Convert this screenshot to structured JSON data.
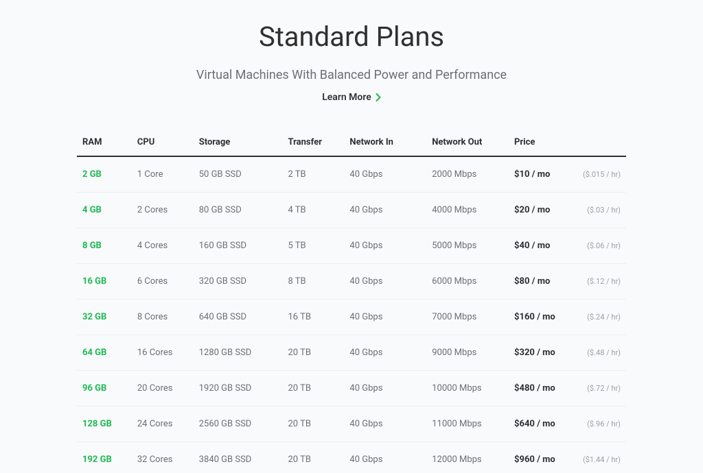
{
  "header": {
    "title": "Standard Plans",
    "subtitle": "Virtual Machines With Balanced Power and Performance",
    "learn_more": "Learn More"
  },
  "columns": {
    "ram": "RAM",
    "cpu": "CPU",
    "storage": "Storage",
    "transfer": "Transfer",
    "net_in": "Network In",
    "net_out": "Network Out",
    "price": "Price"
  },
  "rows": [
    {
      "ram": "2 GB",
      "cpu": "1 Core",
      "storage": "50 GB SSD",
      "transfer": "2 TB",
      "net_in": "40 Gbps",
      "net_out": "2000 Mbps",
      "price": "$10 / mo",
      "price_hr": "($.015 / hr)"
    },
    {
      "ram": "4 GB",
      "cpu": "2 Cores",
      "storage": "80 GB SSD",
      "transfer": "4 TB",
      "net_in": "40 Gbps",
      "net_out": "4000 Mbps",
      "price": "$20 / mo",
      "price_hr": "($.03 / hr)"
    },
    {
      "ram": "8 GB",
      "cpu": "4 Cores",
      "storage": "160 GB SSD",
      "transfer": "5 TB",
      "net_in": "40 Gbps",
      "net_out": "5000 Mbps",
      "price": "$40 / mo",
      "price_hr": "($.06 / hr)"
    },
    {
      "ram": "16 GB",
      "cpu": "6 Cores",
      "storage": "320 GB SSD",
      "transfer": "8 TB",
      "net_in": "40 Gbps",
      "net_out": "6000 Mbps",
      "price": "$80 / mo",
      "price_hr": "($.12 / hr)"
    },
    {
      "ram": "32 GB",
      "cpu": "8 Cores",
      "storage": "640 GB SSD",
      "transfer": "16 TB",
      "net_in": "40 Gbps",
      "net_out": "7000 Mbps",
      "price": "$160 / mo",
      "price_hr": "($.24 / hr)"
    },
    {
      "ram": "64 GB",
      "cpu": "16 Cores",
      "storage": "1280 GB SSD",
      "transfer": "20 TB",
      "net_in": "40 Gbps",
      "net_out": "9000 Mbps",
      "price": "$320 / mo",
      "price_hr": "($.48 / hr)"
    },
    {
      "ram": "96 GB",
      "cpu": "20 Cores",
      "storage": "1920 GB SSD",
      "transfer": "20 TB",
      "net_in": "40 Gbps",
      "net_out": "10000 Mbps",
      "price": "$480 / mo",
      "price_hr": "($.72 / hr)"
    },
    {
      "ram": "128 GB",
      "cpu": "24 Cores",
      "storage": "2560 GB SSD",
      "transfer": "20 TB",
      "net_in": "40 Gbps",
      "net_out": "11000 Mbps",
      "price": "$640 / mo",
      "price_hr": "($.96 / hr)"
    },
    {
      "ram": "192 GB",
      "cpu": "32 Cores",
      "storage": "3840 GB SSD",
      "transfer": "20 TB",
      "net_in": "40 Gbps",
      "net_out": "12000 Mbps",
      "price": "$960 / mo",
      "price_hr": "($1.44 / hr)"
    }
  ],
  "chart_data": {
    "type": "table",
    "title": "Standard Plans",
    "columns": [
      "RAM",
      "CPU",
      "Storage",
      "Transfer",
      "Network In",
      "Network Out",
      "Price / mo",
      "Price / hr"
    ],
    "rows": [
      [
        "2 GB",
        "1 Core",
        "50 GB SSD",
        "2 TB",
        "40 Gbps",
        "2000 Mbps",
        "$10",
        "$0.015"
      ],
      [
        "4 GB",
        "2 Cores",
        "80 GB SSD",
        "4 TB",
        "40 Gbps",
        "4000 Mbps",
        "$20",
        "$0.03"
      ],
      [
        "8 GB",
        "4 Cores",
        "160 GB SSD",
        "5 TB",
        "40 Gbps",
        "5000 Mbps",
        "$40",
        "$0.06"
      ],
      [
        "16 GB",
        "6 Cores",
        "320 GB SSD",
        "8 TB",
        "40 Gbps",
        "6000 Mbps",
        "$80",
        "$0.12"
      ],
      [
        "32 GB",
        "8 Cores",
        "640 GB SSD",
        "16 TB",
        "40 Gbps",
        "7000 Mbps",
        "$160",
        "$0.24"
      ],
      [
        "64 GB",
        "16 Cores",
        "1280 GB SSD",
        "20 TB",
        "40 Gbps",
        "9000 Mbps",
        "$320",
        "$0.48"
      ],
      [
        "96 GB",
        "20 Cores",
        "1920 GB SSD",
        "20 TB",
        "40 Gbps",
        "10000 Mbps",
        "$480",
        "$0.72"
      ],
      [
        "128 GB",
        "24 Cores",
        "2560 GB SSD",
        "20 TB",
        "40 Gbps",
        "11000 Mbps",
        "$640",
        "$0.96"
      ],
      [
        "192 GB",
        "32 Cores",
        "3840 GB SSD",
        "20 TB",
        "40 Gbps",
        "12000 Mbps",
        "$960",
        "$1.44"
      ]
    ]
  }
}
